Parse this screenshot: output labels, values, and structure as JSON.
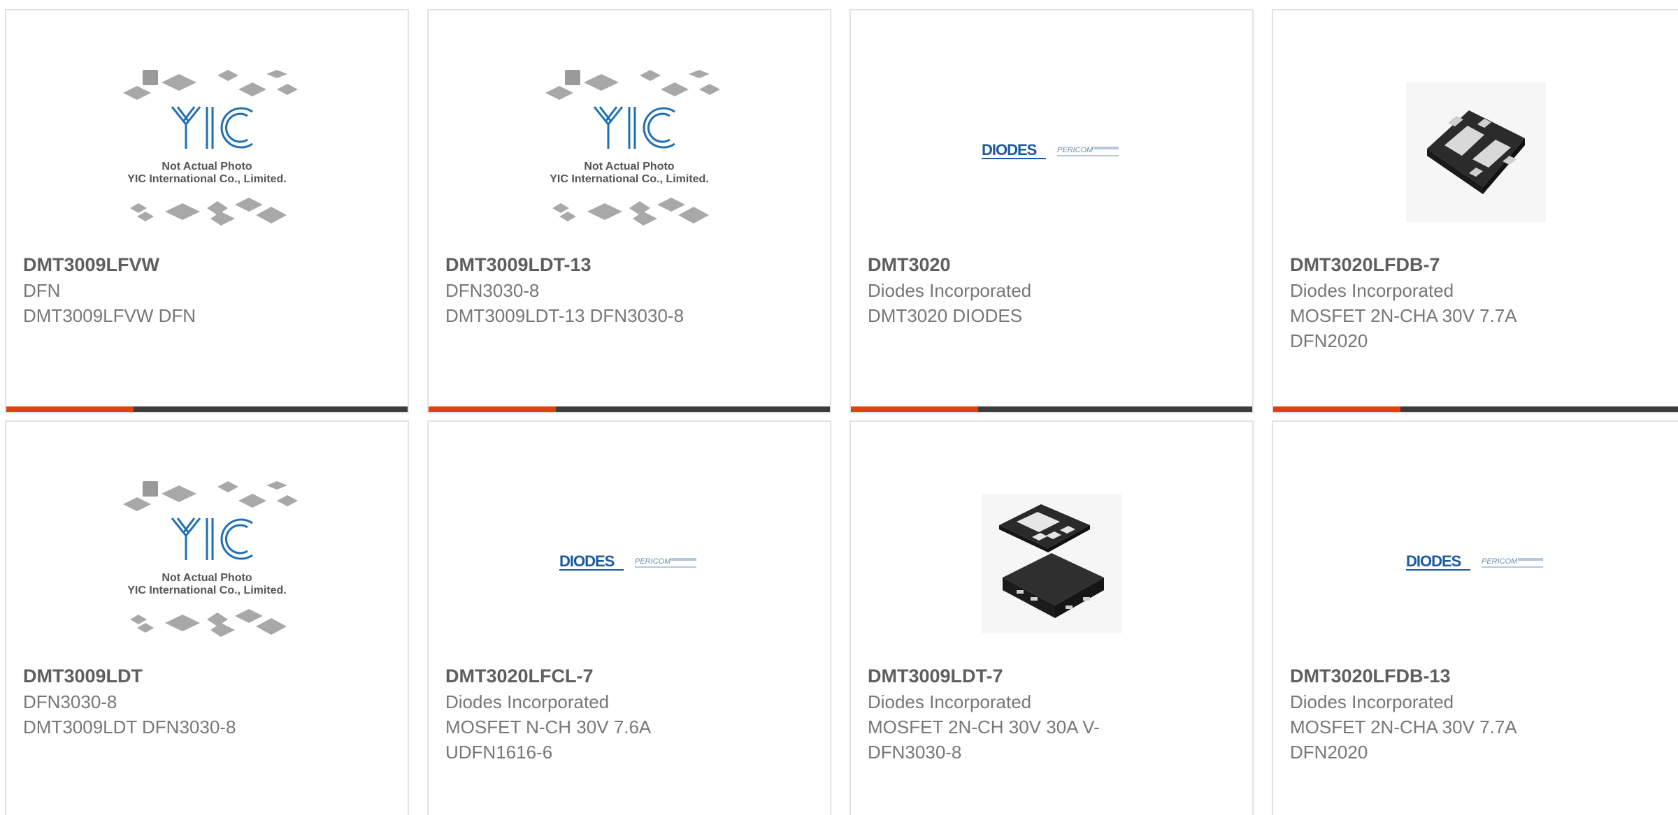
{
  "products": [
    {
      "part": "DMT3009LFVW",
      "line1": "DFN",
      "line2": "DMT3009LFVW DFN",
      "image": "yic-placeholder",
      "image_text": [
        "Not Actual Photo",
        "YIC International Co., Limited."
      ]
    },
    {
      "part": "DMT3009LDT-13",
      "line1": "DFN3030-8",
      "line2": "DMT3009LDT-13 DFN3030-8",
      "image": "yic-placeholder",
      "image_text": [
        "Not Actual Photo",
        "YIC International Co., Limited."
      ]
    },
    {
      "part": "DMT3020",
      "line1": "Diodes Incorporated",
      "line2": "DMT3020 DIODES",
      "image": "diodes-pericom-logo",
      "image_text": [
        "DIODES",
        "PERICOM"
      ]
    },
    {
      "part": "DMT3020LFDB-7",
      "line1": "Diodes Incorporated",
      "line2": "MOSFET 2N-CHA 30V 7.7A",
      "line3": "DFN2020",
      "image": "dfn-chip-photo"
    },
    {
      "part": "DMT3009LDT",
      "line1": "DFN3030-8",
      "line2": "DMT3009LDT DFN3030-8",
      "image": "yic-placeholder",
      "image_text": [
        "Not Actual Photo",
        "YIC International Co., Limited."
      ]
    },
    {
      "part": "DMT3020LFCL-7",
      "line1": "Diodes Incorporated",
      "line2": "MOSFET N-CH 30V 7.6A",
      "line3": "UDFN1616-6",
      "image": "diodes-pericom-logo",
      "image_text": [
        "DIODES",
        "PERICOM"
      ]
    },
    {
      "part": "DMT3009LDT-7",
      "line1": "Diodes Incorporated",
      "line2": "MOSFET 2N-CH 30V 30A V-",
      "line3": "DFN3030-8",
      "image": "vdfn-chip-photo"
    },
    {
      "part": "DMT3020LFDB-13",
      "line1": "Diodes Incorporated",
      "line2": "MOSFET 2N-CHA 30V 7.7A",
      "line3": "DFN2020",
      "image": "diodes-pericom-logo",
      "image_text": [
        "DIODES",
        "PERICOM"
      ]
    }
  ],
  "colors": {
    "accent": "#e2410f",
    "bar": "#3d3d3d",
    "border": "#e2e2e2",
    "yic_blue": "#1f6fb2",
    "diodes_blue": "#1a5aa0"
  }
}
